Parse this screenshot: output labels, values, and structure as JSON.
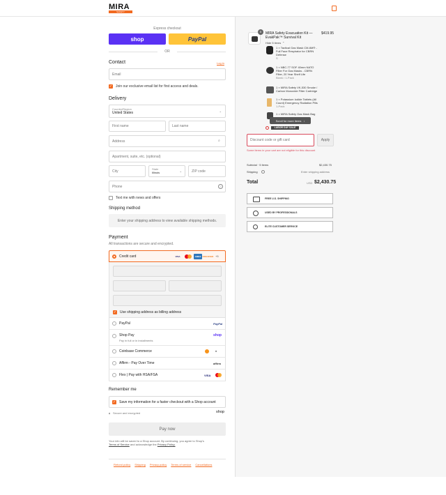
{
  "header": {
    "brand": "MIRA",
    "brand_tagline": "SAFETY",
    "cart_icon": "bag-icon"
  },
  "express": {
    "title": "Express checkout",
    "shop_label": "shop",
    "paypal_label": "PayPal",
    "or_label": "OR"
  },
  "contact": {
    "title": "Contact",
    "login_link": "Log in",
    "email_placeholder": "Email",
    "email_optin": "Join our exclusive email list for first access and deals."
  },
  "delivery": {
    "title": "Delivery",
    "country_label": "Country/Region",
    "country_value": "United States",
    "first_name": "First name",
    "last_name": "Last name",
    "address": "Address",
    "apartment": "Apartment, suite, etc. (optional)",
    "city": "City",
    "state_label": "State",
    "state_value": "Illinois",
    "zip": "ZIP code",
    "phone": "Phone",
    "sms_optin": "Text me with news and offers"
  },
  "shipping_method": {
    "title": "Shipping method",
    "placeholder": "Enter your shipping address to view available shipping methods."
  },
  "payment": {
    "title": "Payment",
    "subtitle": "All transactions are secure and encrypted.",
    "credit_card": "Credit card",
    "more_cards": "+5",
    "card_logos": [
      {
        "name": "VISA",
        "color": "#1a1f71"
      },
      {
        "name": "MC",
        "color": "#eb001b"
      },
      {
        "name": "AMEX",
        "color": "#2e77bc"
      },
      {
        "name": "DISCOVER",
        "color": "#f58220"
      }
    ],
    "billing_same": "Use shipping address as billing address",
    "methods": [
      {
        "label": "PayPal",
        "sub": "",
        "badge": "PayPal",
        "badge_color": "#253b80"
      },
      {
        "label": "Shop Pay",
        "sub": "Pay in full or in installments",
        "badge": "shop",
        "badge_color": "#5a31f4"
      },
      {
        "label": "Coinbase Commerce",
        "sub": "",
        "badge": "",
        "badge_color": "#f7931a"
      },
      {
        "label": "Affirm - Pay Over Time",
        "sub": "",
        "badge": "affirm",
        "badge_color": "#333"
      },
      {
        "label": "Flex | Pay with HSA/FSA",
        "sub": "",
        "badge": "VISA",
        "badge_color": "#1a1f71"
      }
    ]
  },
  "remember": {
    "title": "Remember me",
    "save_label": "Save my information for a faster checkout with a Shop account",
    "secure": "Secure and encrypted",
    "shop_logo": "shop"
  },
  "pay": {
    "label": "Pay now",
    "terms_prefix": "Your info will be saved to a Shop account. By continuing, you agree to Shop's",
    "terms_link": "Terms of Service",
    "terms_mid": "and acknowledge the",
    "privacy_link": "Privacy Policy."
  },
  "footer": {
    "links": [
      "Refund policy",
      "Shipping",
      "Privacy policy",
      "Terms of service",
      "Cancellations"
    ]
  },
  "summary": {
    "product": {
      "qty_badge": "5",
      "title": "MIRA Safety Evacuation Kit — EvakPak™ Survival Kit",
      "price": "$419.95",
      "hide_items": "Hide 5 items"
    },
    "items": [
      {
        "line1": "1 × Tactical Gas Mask CM-6M® -",
        "line2": "Full Face Respirator for CBRN",
        "line3": "Defense",
        "sub": "S"
      },
      {
        "line1": "1 × NBC-77 SOF 40mm NATO",
        "line2": "Filter For Gas Masks - CBRN",
        "line3": "Filter, 20 Year Shelf Life",
        "sub": "Blank / 1-Pack"
      },
      {
        "line1": "1 × MIRA Safety VK-530 Smoke /",
        "line2": "Carbon Monoxide Filter Cartridge",
        "line3": "",
        "sub": ""
      },
      {
        "line1": "1 × Potassium Iodide Tablets (All",
        "line2": "Count) Emergency Radiation Pills",
        "line3": "",
        "sub": "1-Pack"
      },
      {
        "line1": "1 × MIRA Safety Gas Mask Bag",
        "line2": "",
        "line3": "",
        "sub": ""
      }
    ],
    "scroll_hint": "Scroll for more items",
    "labor_day": "LABOR DAY SALE",
    "discount_placeholder": "Discount code or gift card",
    "apply": "Apply",
    "discount_error": "Some items in your cart are not eligible for this discount",
    "subtotal_label": "Subtotal · 5 items",
    "subtotal_value": "$2,430.75",
    "shipping_label": "Shipping",
    "shipping_value": "Enter shipping address",
    "total_label": "Total",
    "currency": "USD",
    "total_value": "$2,430.75",
    "trust": [
      "FREE U.S. SHIPPING",
      "USED BY PROFESSIONALS",
      "ELITE CUSTOMER SERVICE"
    ]
  }
}
